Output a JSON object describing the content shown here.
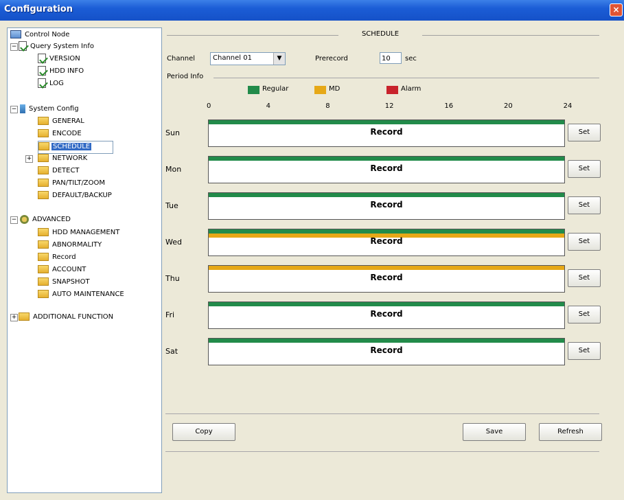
{
  "window": {
    "title": "Configuration",
    "close_icon": "close-icon"
  },
  "tree": {
    "items": [
      {
        "label": "Control Node",
        "icon": "computer-icon"
      },
      {
        "label": "Query System Info",
        "icon": "doc-check-icon"
      },
      {
        "label": "VERSION",
        "icon": "doc-check-icon"
      },
      {
        "label": "HDD INFO",
        "icon": "doc-check-icon"
      },
      {
        "label": "LOG",
        "icon": "doc-check-icon"
      },
      {
        "label": "System Config",
        "icon": "system-icon"
      },
      {
        "label": "GENERAL",
        "icon": "folder-icon"
      },
      {
        "label": "ENCODE",
        "icon": "folder-icon"
      },
      {
        "label": "SCHEDULE",
        "icon": "folder-icon"
      },
      {
        "label": "NETWORK",
        "icon": "folder-icon"
      },
      {
        "label": "DETECT",
        "icon": "folder-icon"
      },
      {
        "label": "PAN/TILT/ZOOM",
        "icon": "folder-icon"
      },
      {
        "label": "DEFAULT/BACKUP",
        "icon": "folder-icon"
      },
      {
        "label": "ADVANCED",
        "icon": "gear-icon"
      },
      {
        "label": "HDD MANAGEMENT",
        "icon": "folder-icon"
      },
      {
        "label": "ABNORMALITY",
        "icon": "folder-icon"
      },
      {
        "label": "Record",
        "icon": "folder-icon"
      },
      {
        "label": "ACCOUNT",
        "icon": "folder-icon"
      },
      {
        "label": "SNAPSHOT",
        "icon": "folder-icon"
      },
      {
        "label": "AUTO MAINTENANCE",
        "icon": "folder-icon"
      },
      {
        "label": "ADDITIONAL FUNCTION",
        "icon": "folder-icon"
      }
    ]
  },
  "schedule": {
    "section_title": "SCHEDULE",
    "channel_label": "Channel",
    "channel_value": "Channel 01",
    "prerecord_label": "Prerecord",
    "prerecord_value": "10",
    "prerecord_unit": "sec",
    "period_label": "Period Info",
    "legend": [
      {
        "label": "Regular",
        "color": "#228b4a"
      },
      {
        "label": "MD",
        "color": "#e6a817"
      },
      {
        "label": "Alarm",
        "color": "#c8232c"
      }
    ],
    "hours": [
      "0",
      "4",
      "8",
      "12",
      "16",
      "20",
      "24"
    ],
    "days": [
      {
        "label": "Sun",
        "bars": [
          "regular"
        ],
        "record_label": "Record",
        "set_label": "Set"
      },
      {
        "label": "Mon",
        "bars": [
          "regular"
        ],
        "record_label": "Record",
        "set_label": "Set"
      },
      {
        "label": "Tue",
        "bars": [
          "regular"
        ],
        "record_label": "Record",
        "set_label": "Set"
      },
      {
        "label": "Wed",
        "bars": [
          "regular",
          "md"
        ],
        "record_label": "Record",
        "set_label": "Set"
      },
      {
        "label": "Thu",
        "bars": [
          "md"
        ],
        "record_label": "Record",
        "set_label": "Set"
      },
      {
        "label": "Fri",
        "bars": [
          "regular"
        ],
        "record_label": "Record",
        "set_label": "Set"
      },
      {
        "label": "Sat",
        "bars": [
          "regular"
        ],
        "record_label": "Record",
        "set_label": "Set"
      }
    ]
  },
  "buttons": {
    "copy": "Copy",
    "save": "Save",
    "refresh": "Refresh"
  }
}
